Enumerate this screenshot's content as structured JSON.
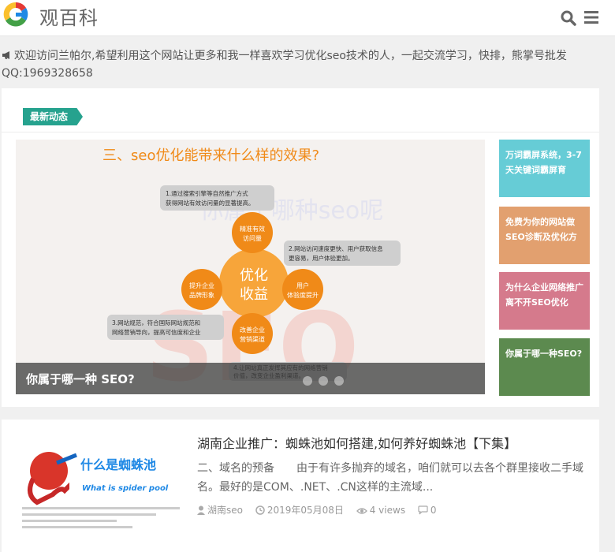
{
  "header": {
    "site_title": "观百科",
    "logo_colors": [
      "#e53935",
      "#fbc02d",
      "#43a047",
      "#1e88e5"
    ]
  },
  "notice": {
    "line1": "欢迎访问兰帕尔,希望利用这个网站让更多和我一样喜欢学习优化seo技术的人，一起交流学习，快排，熊掌号批发",
    "line2": "QQ:1969328658"
  },
  "featured": {
    "tab_label": "最新动态",
    "slide": {
      "caption": "你属于哪一种 SEO?",
      "image_heading": "三、seo优化能带来什么样的效果?",
      "image_watermark": "你属于哪种seo呢",
      "center_label_1": "优化",
      "center_label_2": "收益",
      "circles": [
        "精准有效访问量",
        "用户体验度提升",
        "改善企业营销渠道",
        "提升企业品牌形象"
      ],
      "notes": [
        "1.通过搜索引擎等自然推广方式获得网站有效访问量的显著提高。",
        "2.网站访问速度更快、用户获取信息更容易，用户体验更加。",
        "3.网站规范，符合国际网站规范和网络营销导向，提高可信度和企业网络品牌形象。",
        "4.让网站真正发挥其应有的网络营销价值，改变企业盈利渠道。"
      ],
      "dots": 3
    },
    "tiles": [
      "万词霸屏系统，3-7天关键词霸屏育",
      "免费为你的网站做SEO诊断及优化方",
      "为什么企业网络推广离不开SEO优化",
      "你属于哪一种SEO?"
    ]
  },
  "article": {
    "title": "湖南企业推广：蜘蛛池如何搭建,如何养好蜘蛛池【下集】",
    "excerpt": "二、域名的预备　　由于有许多抛弃的域名，咱们就可以去各个群里接收二手域名。最好的是COM、.NET、.CN这样的主流域...",
    "author": "湖南seo",
    "date": "2019年05月08日",
    "views": "4 views",
    "comments": "0",
    "thumb_title": "什么是蜘蛛池",
    "thumb_subtitle": "What is spider pool"
  }
}
